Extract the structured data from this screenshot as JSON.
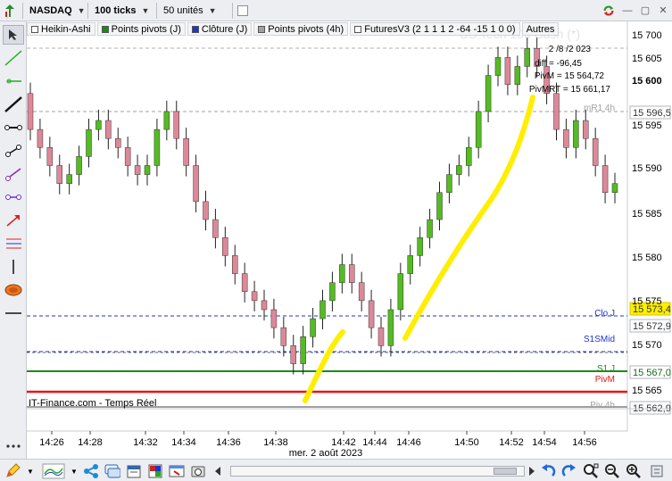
{
  "toolbar": {
    "symbol": "NASDAQ",
    "ticks": "100 ticks",
    "units": "50 unités"
  },
  "indicators": [
    {
      "label": "Heikin-Ashi",
      "color": "#ffffff"
    },
    {
      "label": "Points pivots (J)",
      "color": "#1a8a1a"
    },
    {
      "label": "Clôture (J)",
      "color": "#2233cc"
    },
    {
      "label": "Points pivots (4h)",
      "color": "#a0a0a0"
    },
    {
      "label": "FuturesV3 (2 1 1 1 2 -64 -15 1 0 0)",
      "color": "#ffffff"
    },
    {
      "label": "Autres",
      "color": ""
    }
  ],
  "watermark": "US Tech 100 Cash (*)",
  "annotation": {
    "date": "2 /8 /2 023",
    "diff": "diff = -96,45",
    "pivm": "PivM = 15 564,72",
    "pivmrt": "PivMRT = 15 661,17"
  },
  "price_axis": {
    "ticks": [
      "15 700",
      "15 605",
      "15 600",
      "15 595",
      "15 590",
      "15 585",
      "15 580",
      "15 575",
      "15 570",
      "15 565"
    ],
    "current_price": "15 573,4"
  },
  "levels": [
    {
      "name": "mR1 4h",
      "price": 15596.5,
      "price_label": "15 596,5",
      "color": "#a0a0a0",
      "style": "dashed"
    },
    {
      "name": "Clo J",
      "price": 15573.4,
      "price_label": "15 573,4",
      "color": "#2233cc",
      "style": "dashed"
    },
    {
      "name": "S1SMid",
      "price": 15569.0,
      "price_label": "15 572,9",
      "color": "#2233cc",
      "style": "dashed"
    },
    {
      "name": "S1 J",
      "price": 15567.0,
      "price_label": "15 567,0",
      "color": "#1a8a1a",
      "style": "solid"
    },
    {
      "name": "PivM",
      "price": 15564.8,
      "price_label": "",
      "color": "#ee1111",
      "style": "solid"
    },
    {
      "name": "Piv 4h",
      "price": 15562.9,
      "price_label": "15 562,9",
      "color": "#a0a0a0",
      "style": "solid"
    }
  ],
  "source_label": "IT-Finance.com - Temps Réel",
  "time_axis": {
    "ticks": [
      "14:26",
      "14:28",
      "14:32",
      "14:34",
      "14:36",
      "14:38",
      "14:42",
      "14:44",
      "14:46",
      "14:50",
      "14:52",
      "14:54",
      "14:56"
    ],
    "date": "mer. 2 août 2023"
  },
  "colors": {
    "bull": "#55bb22",
    "bear": "#dd8899",
    "highlight": "#ffee00",
    "current_price_bg": "#ffee00"
  },
  "chart_data": {
    "type": "candlestick",
    "ylim": [
      15561,
      15604
    ],
    "opens": [
      15596,
      15592,
      15590,
      15588,
      15586,
      15587,
      15589,
      15592,
      15593,
      15591,
      15590,
      15588,
      15587,
      15588,
      15592,
      15594,
      15591,
      15588,
      15584,
      15582,
      15580,
      15578,
      15576,
      15574,
      15573,
      15572,
      15570,
      15568,
      15566,
      15569,
      15571,
      15573,
      15575,
      15577,
      15575,
      15573,
      15570,
      15568,
      15572,
      15576,
      15578,
      15580,
      15582,
      15585,
      15587,
      15588,
      15590,
      15594,
      15598,
      15600,
      15597,
      15599,
      15601,
      15599,
      15596,
      15592,
      15590,
      15593,
      15591,
      15588,
      15585
    ],
    "closes": [
      15592,
      15590,
      15588,
      15586,
      15587,
      15589,
      15592,
      15593,
      15591,
      15590,
      15588,
      15587,
      15588,
      15592,
      15594,
      15591,
      15588,
      15584,
      15582,
      15580,
      15578,
      15576,
      15574,
      15573,
      15572,
      15570,
      15568,
      15566,
      15569,
      15571,
      15573,
      15575,
      15577,
      15575,
      15573,
      15570,
      15568,
      15572,
      15576,
      15578,
      15580,
      15582,
      15585,
      15587,
      15588,
      15590,
      15594,
      15598,
      15600,
      15597,
      15599,
      15601,
      15599,
      15596,
      15592,
      15590,
      15593,
      15591,
      15588,
      15585,
      15586
    ]
  }
}
